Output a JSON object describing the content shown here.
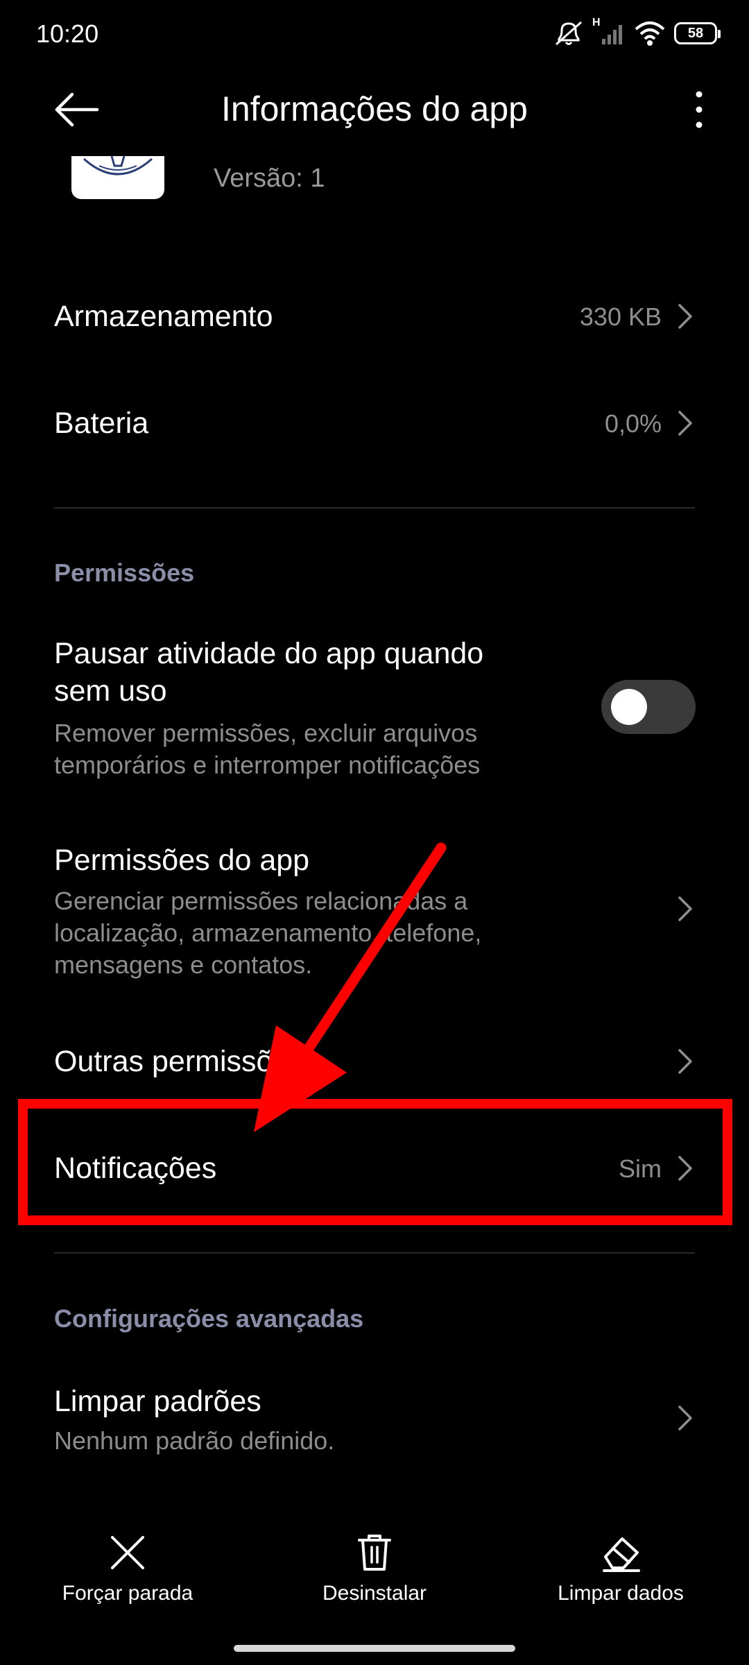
{
  "status_bar": {
    "time": "10:20",
    "network_label": "H",
    "battery": "58",
    "icons": [
      "mute-icon",
      "signal-icon",
      "wifi-icon",
      "battery-icon"
    ]
  },
  "header": {
    "title": "Informações do app",
    "back_icon": "back-arrow-icon",
    "menu_icon": "more-vert-icon"
  },
  "app": {
    "version": "Versão: 1"
  },
  "rows": {
    "storage": {
      "title": "Armazenamento",
      "value": "330 KB"
    },
    "battery": {
      "title": "Bateria",
      "value": "0,0%"
    },
    "pause": {
      "title_line1": "Pausar atividade do app quando",
      "title_line2": "sem uso",
      "sub_line1": "Remover permissões, excluir arquivos",
      "sub_line2": "temporários e interromper notificações",
      "toggle_on": false
    },
    "app_permissions": {
      "title": "Permissões do app",
      "sub_line1": "Gerenciar permissões relacionadas a",
      "sub_line2": "localização, armazenamento, telefone,",
      "sub_line3": "mensagens e contatos."
    },
    "other_permissions": {
      "title": "Outras permissões"
    },
    "notifications": {
      "title": "Notificações",
      "value": "Sim"
    },
    "clear_defaults": {
      "title": "Limpar padrões",
      "sub": "Nenhum padrão definido."
    }
  },
  "sections": {
    "permissions": "Permissões",
    "advanced": "Configurações avançadas"
  },
  "bottom_bar": {
    "force_stop": "Forçar parada",
    "uninstall": "Desinstalar",
    "clear_data": "Limpar dados"
  },
  "colors": {
    "background": "#000000",
    "section_header": "#8b8ea8",
    "highlight": "#ff0000",
    "secondary_text": "#8f8f8f"
  }
}
